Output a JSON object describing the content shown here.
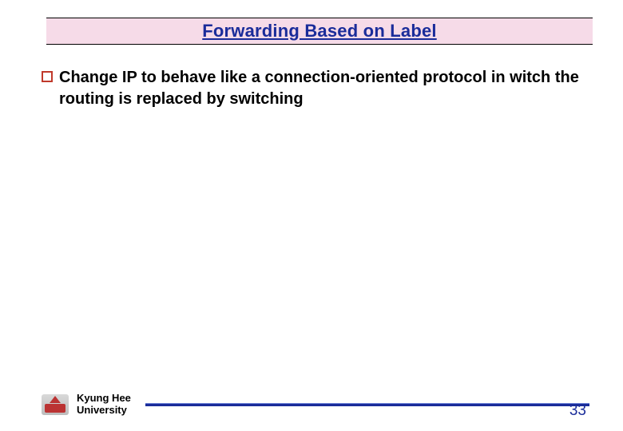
{
  "title": "Forwarding Based on Label",
  "bullets": [
    "Change IP to behave like a connection-oriented protocol in witch the routing is replaced by switching"
  ],
  "footer": {
    "org_line1": "Kyung Hee",
    "org_line2": "University",
    "page_number": "33"
  }
}
